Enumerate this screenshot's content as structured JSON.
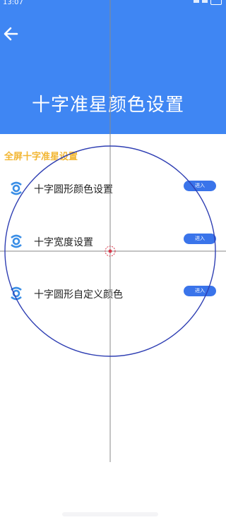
{
  "status_bar": {
    "time": "13:07"
  },
  "header": {
    "back_icon": "arrow-left-icon",
    "title": "十字准星颜色设置"
  },
  "section": {
    "label": "全屏十字准星设置"
  },
  "rows": [
    {
      "label": "十字圆形颜色设置",
      "button": "进入",
      "icon": "settings-icon"
    },
    {
      "label": "十字宽度设置",
      "button": "进入",
      "icon": "settings-icon"
    },
    {
      "label": "十字圆形自定义颜色",
      "button": "进入",
      "icon": "settings-icon"
    }
  ],
  "colors": {
    "header_bg": "#3f86f3",
    "section_label": "#f2b632",
    "button_bg": "#3a74ea",
    "circle_stroke": "#2f3fb3",
    "center_marker": "#d9384a"
  }
}
